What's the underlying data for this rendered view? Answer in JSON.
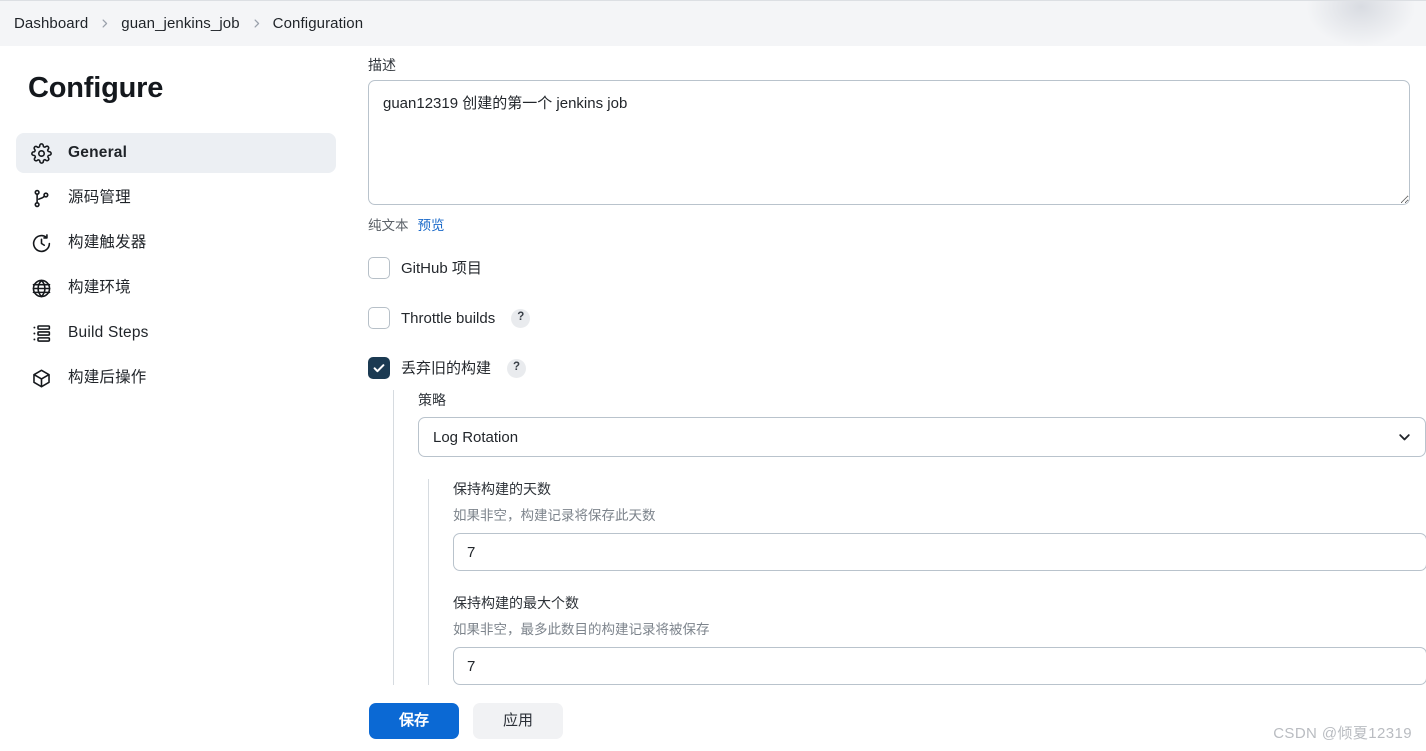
{
  "breadcrumb": {
    "items": [
      {
        "label": "Dashboard"
      },
      {
        "label": "guan_jenkins_job"
      },
      {
        "label": "Configuration"
      }
    ]
  },
  "sidebar": {
    "title": "Configure",
    "items": [
      {
        "label": "General",
        "icon": "gear-icon",
        "active": true
      },
      {
        "label": "源码管理",
        "icon": "git-branch-icon",
        "active": false
      },
      {
        "label": "构建触发器",
        "icon": "clock-icon",
        "active": false
      },
      {
        "label": "构建环境",
        "icon": "globe-icon",
        "active": false
      },
      {
        "label": "Build Steps",
        "icon": "list-steps-icon",
        "active": false
      },
      {
        "label": "构建后操作",
        "icon": "package-icon",
        "active": false
      }
    ]
  },
  "form": {
    "description": {
      "label": "描述",
      "value": "guan12319 创建的第一个 jenkins job",
      "placeholder": "",
      "plain_text_label": "纯文本",
      "preview_label": "预览"
    },
    "checkboxes": [
      {
        "label": "GitHub 项目",
        "checked": false,
        "help": false
      },
      {
        "label": "Throttle builds",
        "checked": false,
        "help": true,
        "help_glyph": "?"
      },
      {
        "label": "丢弃旧的构建",
        "checked": true,
        "help": true,
        "help_glyph": "?"
      }
    ],
    "discard_section": {
      "strategy_label": "策略",
      "strategy_value": "Log Rotation",
      "strategy_options": [
        "Log Rotation"
      ],
      "fields": [
        {
          "title": "保持构建的天数",
          "help": "如果非空，构建记录将保存此天数",
          "value": "7"
        },
        {
          "title": "保持构建的最大个数",
          "help": "如果非空，最多此数目的构建记录将被保存",
          "value": "7"
        }
      ]
    }
  },
  "actions": {
    "save_label": "保存",
    "apply_label": "应用"
  },
  "watermark": "CSDN @倾夏12319",
  "colors": {
    "primary_button": "#0b69d4",
    "checkbox_checked": "#1b3a52",
    "link": "#1b6ac9",
    "topbar_bg": "#f4f5f7",
    "active_nav_bg": "#eceff3"
  }
}
